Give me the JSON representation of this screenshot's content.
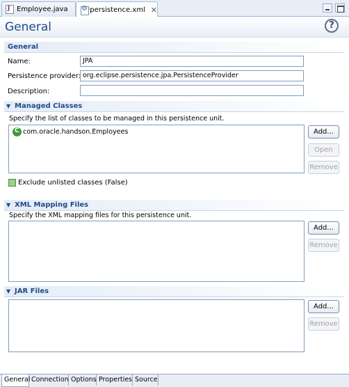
{
  "editor_tabs": [
    {
      "label": "Employee.java",
      "icon": "java-file-icon"
    },
    {
      "label": "*persistence.xml",
      "icon": "persistence-xml-icon"
    }
  ],
  "form": {
    "title": "General",
    "help_glyph": "?"
  },
  "general": {
    "title": "General",
    "name_label": "Name:",
    "name_value": "JPA",
    "provider_label": "Persistence provider:",
    "provider_value": "org.eclipse.persistence.jpa.PersistenceProvider",
    "description_label": "Description:",
    "description_value": ""
  },
  "managed_classes": {
    "title": "Managed Classes",
    "description": "Specify the list of classes to be managed in this persistence unit.",
    "items": [
      "com.oracle.handson.Employees"
    ],
    "add_label": "Add...",
    "open_label": "Open",
    "remove_label": "Remove",
    "exclude_label": "Exclude unlisted classes (False)"
  },
  "xml_mapping": {
    "title": "XML Mapping Files",
    "description": "Specify the XML mapping files for this persistence unit.",
    "add_label": "Add...",
    "remove_label": "Remove"
  },
  "jar_files": {
    "title": "JAR Files",
    "add_label": "Add...",
    "remove_label": "Remove"
  },
  "page_tabs": [
    "General",
    "Connection",
    "Options",
    "Properties",
    "Source"
  ],
  "colors": {
    "section_title": "#1f4a8a",
    "field_border": "#7f9db9",
    "tab_active_bg": "#ffffff"
  }
}
